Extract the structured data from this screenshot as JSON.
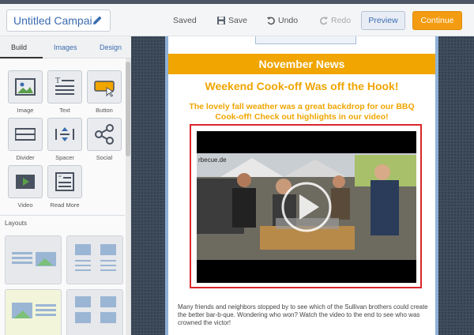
{
  "app": {
    "campaign_title": "Untitled Campai",
    "status": "Saved",
    "save_label": "Save",
    "undo_label": "Undo",
    "redo_label": "Redo",
    "preview_label": "Preview",
    "continue_label": "Continue",
    "accent_color": "#f39c12"
  },
  "sidebar": {
    "tabs": [
      {
        "label": "Build",
        "active": true
      },
      {
        "label": "Images",
        "active": false
      },
      {
        "label": "Design",
        "active": false
      }
    ],
    "blocks": [
      {
        "label": "Image",
        "icon": "image-icon"
      },
      {
        "label": "Text",
        "icon": "text-icon"
      },
      {
        "label": "Button",
        "icon": "button-icon"
      },
      {
        "label": "Divider",
        "icon": "divider-icon"
      },
      {
        "label": "Spacer",
        "icon": "spacer-icon"
      },
      {
        "label": "Social",
        "icon": "share-icon"
      },
      {
        "label": "Video",
        "icon": "video-icon"
      },
      {
        "label": "Read More",
        "icon": "read-more-icon"
      }
    ],
    "layouts_heading": "Layouts"
  },
  "email": {
    "banner": "November News",
    "headline": "Weekend Cook-off Was off the Hook!",
    "subhead": "The lovely fall weather was a great backdrop for our BBQ Cook-off! Check out highlights in our video!",
    "video_sign_text": "rbecue.de",
    "body": "Many friends and neighbors stopped by to see which of the Sullivan brothers could create the better bar-b-que. Wondering who won? Watch the video to the end to see who was crowned the victor!",
    "banner_color": "#f0a500",
    "selection_color": "#d9262c"
  }
}
